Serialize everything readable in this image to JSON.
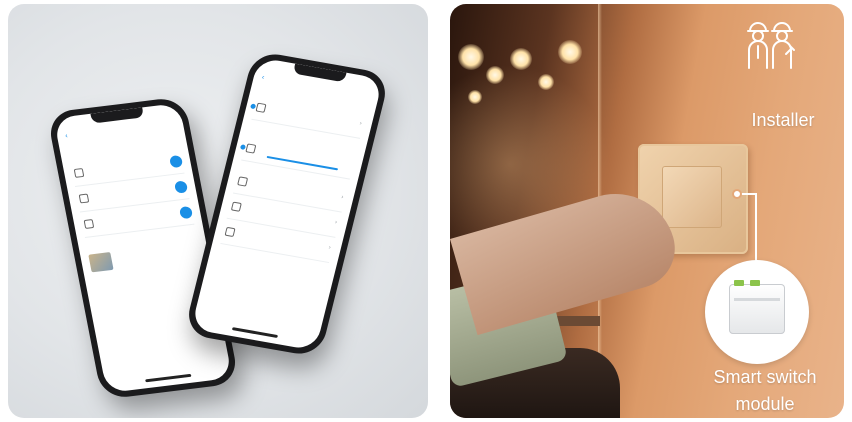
{
  "right_panel": {
    "installer_label": "Installer",
    "installer_icon": "installer-workers-icon",
    "module_label_line1": "Smart switch",
    "module_label_line2": "module"
  },
  "left_panel": {
    "phone_icons": [
      "chevron-left-icon",
      "toggle-icon",
      "chevron-right-icon"
    ]
  },
  "colors": {
    "accent_blue": "#1a8fe6",
    "label_white": "#ffffff",
    "wall_warm": "#e4a879"
  }
}
